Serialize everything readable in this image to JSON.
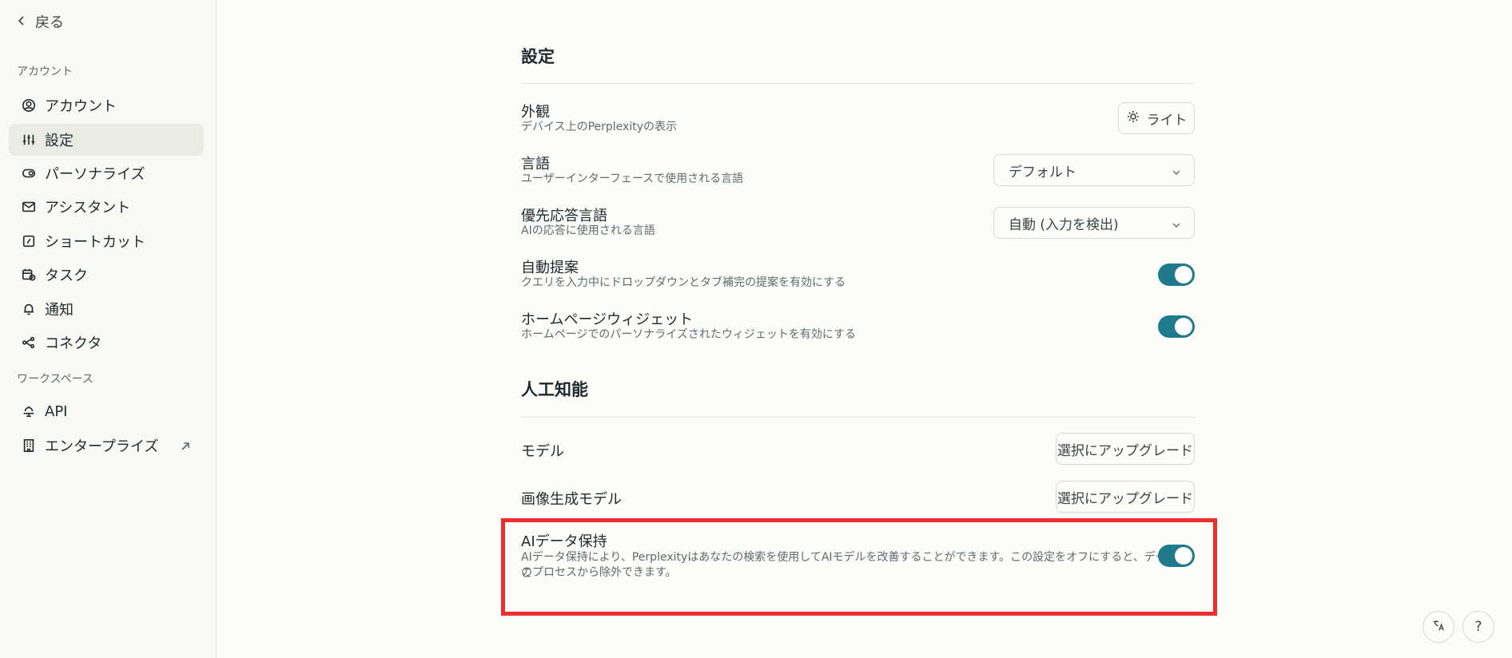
{
  "sidebar": {
    "back_label": "戻る",
    "account_section": "アカウント",
    "workspace_section": "ワークスペース",
    "items": [
      {
        "label": "アカウント",
        "icon": "user-circle-icon"
      },
      {
        "label": "設定",
        "icon": "sliders-icon"
      },
      {
        "label": "パーソナライズ",
        "icon": "toggle-icon"
      },
      {
        "label": "アシスタント",
        "icon": "mail-icon"
      },
      {
        "label": "ショートカット",
        "icon": "shortcut-icon"
      },
      {
        "label": "タスク",
        "icon": "calendar-clock-icon"
      },
      {
        "label": "通知",
        "icon": "bell-icon"
      },
      {
        "label": "コネクタ",
        "icon": "connector-icon"
      }
    ],
    "workspace_items": [
      {
        "label": "API",
        "icon": "api-icon"
      },
      {
        "label": "エンタープライズ",
        "icon": "building-icon"
      }
    ]
  },
  "settings": {
    "title": "設定",
    "appearance": {
      "title": "外観",
      "desc": "デバイス上のPerplexityの表示",
      "button": "ライト"
    },
    "language": {
      "title": "言語",
      "desc": "ユーザーインターフェースで使用される言語",
      "value": "デフォルト"
    },
    "response_language": {
      "title": "優先応答言語",
      "desc": "AIの応答に使用される言語",
      "value": "自動 (入力を検出)"
    },
    "autosuggest": {
      "title": "自動提案",
      "desc": "クエリを入力中にドロップダウンとタブ補完の提案を有効にする",
      "enabled": true
    },
    "homepage_widget": {
      "title": "ホームページウィジェット",
      "desc": "ホームページでのパーソナライズされたウィジェットを有効にする",
      "enabled": true
    }
  },
  "ai": {
    "title": "人工知能",
    "model": {
      "title": "モデル",
      "button": "選択にアップグレード"
    },
    "image_model": {
      "title": "画像生成モデル",
      "button": "選択にアップグレード"
    },
    "data_retention": {
      "title": "AIデータ保持",
      "desc_line1": "AIデータ保持により、Perplexityはあなたの検索を使用してAIモデルを改善することができます。この設定をオフにすると、データをこ",
      "desc_line2": "のプロセスから除外できます。",
      "enabled": true
    }
  },
  "corner": {
    "translate_icon": "translate-icon",
    "help_label": "?"
  },
  "colors": {
    "accent": "#1f7a8c",
    "highlight": "#ee2d2d"
  }
}
